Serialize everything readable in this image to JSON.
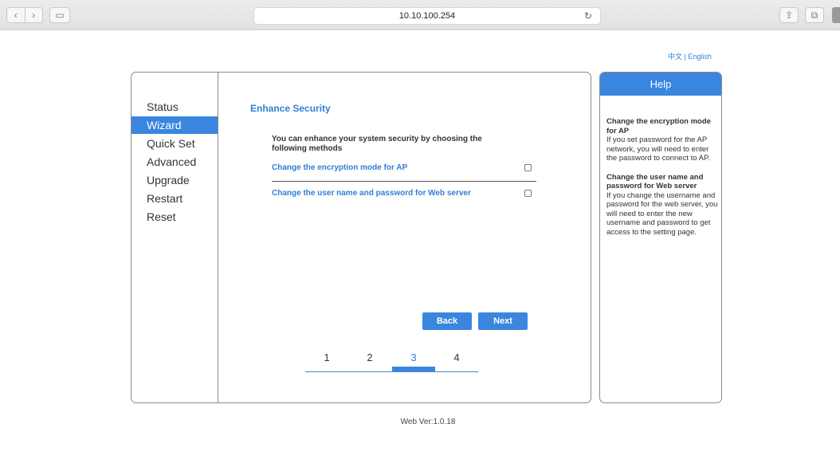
{
  "browser": {
    "url": "10.10.100.254",
    "back_glyph": "‹",
    "forward_glyph": "›",
    "sidebar_glyph": "▭",
    "reload_glyph": "↻",
    "share_glyph": "⇪",
    "tabs_glyph": "⧉"
  },
  "language": {
    "chinese": "中文",
    "separator": "|",
    "english": "English"
  },
  "menu": {
    "items": [
      {
        "label": "Status"
      },
      {
        "label": "Wizard"
      },
      {
        "label": "Quick Set"
      },
      {
        "label": "Advanced"
      },
      {
        "label": "Upgrade"
      },
      {
        "label": "Restart"
      },
      {
        "label": "Reset"
      }
    ],
    "active": "Wizard"
  },
  "content": {
    "title": "Enhance Security",
    "intro": "You can enhance your system security by choosing the following methods",
    "options": [
      {
        "label": "Change the encryption mode for AP",
        "checked": false
      },
      {
        "label": "Change the user name and password for Web server",
        "checked": false
      }
    ],
    "back_label": "Back",
    "next_label": "Next",
    "steps": [
      "1",
      "2",
      "3",
      "4"
    ],
    "current_step": "3"
  },
  "help": {
    "title": "Help",
    "sections": [
      {
        "heading": "Change the encryption mode for AP",
        "text": "If you set password for the AP network, you will need to enter the password to connect to AP."
      },
      {
        "heading": "Change the user name and password for Web server",
        "text": "If you change the username and password for the web server, you will need to enter the new username and password to get access to the setting page."
      }
    ]
  },
  "footer": {
    "version": "Web Ver:1.0.18"
  },
  "colors": {
    "accent": "#3a86df",
    "link": "#2f7fd6",
    "border": "#8a8a8a"
  }
}
